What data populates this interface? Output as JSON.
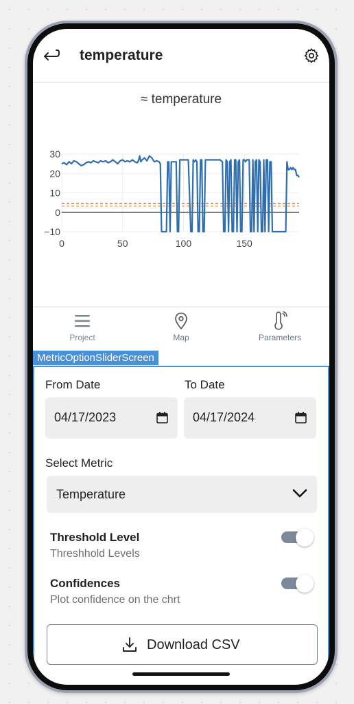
{
  "header": {
    "title": "temperature",
    "back_icon": "return-arrow-icon",
    "settings_icon": "gear-icon"
  },
  "chart_data": {
    "type": "line",
    "title": "≈ temperature",
    "xlim": [
      0,
      195
    ],
    "ylim": [
      -10,
      30
    ],
    "xticks": [
      0,
      50,
      100,
      150
    ],
    "yticks": [
      30,
      20,
      10,
      0,
      -10
    ],
    "grid": true,
    "series": [
      {
        "color": "#2f6fb0",
        "points": [
          [
            0,
            25
          ],
          [
            2,
            25.5
          ],
          [
            4,
            24.5
          ],
          [
            6,
            26
          ],
          [
            8,
            25
          ],
          [
            10,
            26.5
          ],
          [
            12,
            26
          ],
          [
            14,
            25
          ],
          [
            16,
            24
          ],
          [
            18,
            24.5
          ],
          [
            20,
            25.5
          ],
          [
            22,
            26
          ],
          [
            24,
            25.5
          ],
          [
            26,
            26.5
          ],
          [
            28,
            26
          ],
          [
            30,
            25.5
          ],
          [
            32,
            26.5
          ],
          [
            34,
            26
          ],
          [
            36,
            26.5
          ],
          [
            38,
            25.5
          ],
          [
            40,
            26
          ],
          [
            42,
            27
          ],
          [
            44,
            26
          ],
          [
            46,
            25
          ],
          [
            48,
            26.5
          ],
          [
            50,
            27
          ],
          [
            52,
            26
          ],
          [
            54,
            26.5
          ],
          [
            56,
            26
          ],
          [
            58,
            27
          ],
          [
            60,
            26
          ],
          [
            62,
            25.5
          ],
          [
            63,
            26.5
          ],
          [
            64,
            29
          ],
          [
            65,
            26
          ],
          [
            66,
            27
          ],
          [
            68,
            28
          ],
          [
            70,
            26.5
          ],
          [
            72,
            29
          ],
          [
            74,
            28
          ],
          [
            76,
            26
          ],
          [
            78,
            26.5
          ],
          [
            80,
            26
          ],
          [
            81,
            25
          ],
          [
            82,
            -10
          ],
          [
            84,
            -10
          ],
          [
            86,
            -10
          ],
          [
            87,
            26
          ],
          [
            88,
            26
          ],
          [
            89,
            -10
          ],
          [
            90,
            26
          ],
          [
            92,
            26
          ],
          [
            94,
            26
          ],
          [
            95,
            -10
          ],
          [
            96,
            -10
          ],
          [
            97,
            27
          ],
          [
            98,
            27
          ],
          [
            100,
            27
          ],
          [
            102,
            27
          ],
          [
            104,
            27
          ],
          [
            106,
            -10
          ],
          [
            107,
            -10
          ],
          [
            108,
            27
          ],
          [
            109,
            26
          ],
          [
            110,
            27
          ],
          [
            111,
            26
          ],
          [
            112,
            -10
          ],
          [
            113,
            -10
          ],
          [
            114,
            27
          ],
          [
            115,
            27
          ],
          [
            116,
            -10
          ],
          [
            117,
            -10
          ],
          [
            118,
            27
          ],
          [
            120,
            27
          ],
          [
            122,
            27
          ],
          [
            124,
            27
          ],
          [
            126,
            27
          ],
          [
            128,
            27
          ],
          [
            130,
            27
          ],
          [
            132,
            26
          ],
          [
            133,
            -10
          ],
          [
            134,
            -10
          ],
          [
            135,
            27
          ],
          [
            136,
            26
          ],
          [
            137,
            -10
          ],
          [
            138,
            26
          ],
          [
            139,
            27
          ],
          [
            140,
            -10
          ],
          [
            141,
            -10
          ],
          [
            142,
            27
          ],
          [
            143,
            27
          ],
          [
            144,
            -10
          ],
          [
            145,
            26
          ],
          [
            146,
            27
          ],
          [
            147,
            -10
          ],
          [
            148,
            -10
          ],
          [
            149,
            27
          ],
          [
            150,
            27
          ],
          [
            151,
            26
          ],
          [
            152,
            27
          ],
          [
            153,
            27
          ],
          [
            154,
            27
          ],
          [
            155,
            -10
          ],
          [
            156,
            -10
          ],
          [
            157,
            27
          ],
          [
            158,
            -10
          ],
          [
            159,
            26
          ],
          [
            160,
            27
          ],
          [
            161,
            -10
          ],
          [
            162,
            27
          ],
          [
            163,
            26
          ],
          [
            164,
            -10
          ],
          [
            165,
            -10
          ],
          [
            166,
            27
          ],
          [
            167,
            -10
          ],
          [
            168,
            27
          ],
          [
            169,
            27
          ],
          [
            170,
            -10
          ],
          [
            171,
            26
          ],
          [
            172,
            26
          ],
          [
            173,
            -10
          ],
          [
            174,
            -10
          ],
          [
            175,
            -10
          ],
          [
            176,
            -10
          ],
          [
            177,
            -10
          ],
          [
            178,
            -10
          ],
          [
            179,
            -10
          ],
          [
            180,
            -10
          ],
          [
            181,
            -10
          ],
          [
            182,
            -10
          ],
          [
            183,
            -10
          ],
          [
            184,
            -10
          ],
          [
            185,
            26
          ],
          [
            186,
            22
          ],
          [
            187,
            22
          ],
          [
            188,
            23
          ],
          [
            189,
            22
          ],
          [
            190,
            23
          ],
          [
            191,
            22
          ],
          [
            192,
            22
          ],
          [
            193,
            19
          ],
          [
            194,
            19
          ],
          [
            195,
            18
          ]
        ]
      }
    ],
    "thresholds": [
      {
        "y": 4.5,
        "color": "#e06a4a",
        "style": "dashed"
      },
      {
        "y": 3.2,
        "color": "#f2b233",
        "style": "dashed"
      }
    ],
    "zero_line_color": "#222222"
  },
  "tabs": [
    {
      "label": "Project",
      "icon": "hamburger-menu-icon",
      "active": true
    },
    {
      "label": "Map",
      "icon": "map-pin-icon",
      "active": false
    },
    {
      "label": "Parameters",
      "icon": "thermometer-icon",
      "active": false
    }
  ],
  "panel": {
    "tag": "MetricOptionSliderScreen",
    "from_date_label": "From Date",
    "from_date_value": "04/17/2023",
    "to_date_label": "To Date",
    "to_date_value": "04/17/2024",
    "select_metric_label": "Select Metric",
    "select_metric_value": "Temperature",
    "threshold_title": "Threshold Level",
    "threshold_subtitle": "Threshhold Levels",
    "threshold_enabled": true,
    "confidences_title": "Confidences",
    "confidences_subtitle": "Plot confidence on the chrt",
    "confidences_enabled": true,
    "download_label": "Download CSV"
  }
}
